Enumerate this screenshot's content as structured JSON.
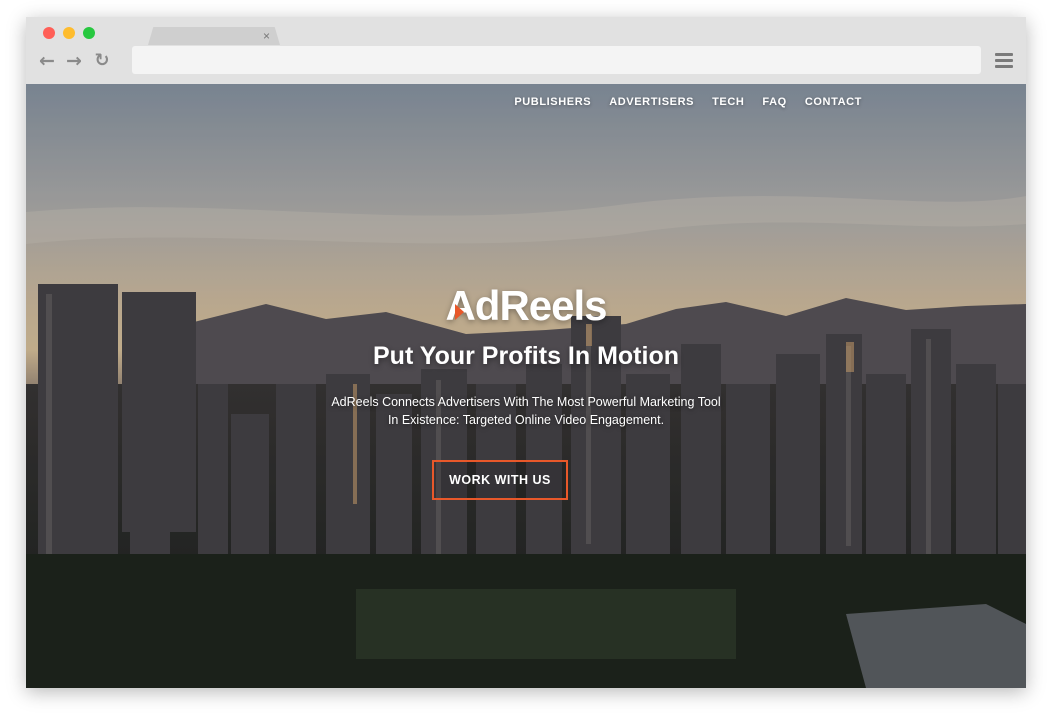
{
  "browser": {
    "tab": {
      "close_glyph": "×"
    },
    "url": "",
    "icons": {
      "back": "arrow-left-icon",
      "forward": "arrow-right-icon",
      "reload": "reload-icon",
      "menu": "hamburger-menu-icon"
    },
    "traffic_lights": {
      "red": "#ff5f57",
      "yellow": "#febc2e",
      "green": "#28c840"
    }
  },
  "nav": {
    "items": [
      "PUBLISHERS",
      "ADVERTISERS",
      "TECH",
      "FAQ",
      "CONTACT"
    ]
  },
  "hero": {
    "logo_text": "AdReels",
    "headline": "Put Your Profits In Motion",
    "subtext_line1": "AdReels Connects Advertisers With The Most Powerful Marketing Tool",
    "subtext_line2": "In Existence: Targeted Online Video Engagement.",
    "cta_label": "WORK WITH US"
  },
  "colors": {
    "accent": "#e8582a",
    "text": "#ffffff",
    "chrome": "#e1e1e1"
  }
}
